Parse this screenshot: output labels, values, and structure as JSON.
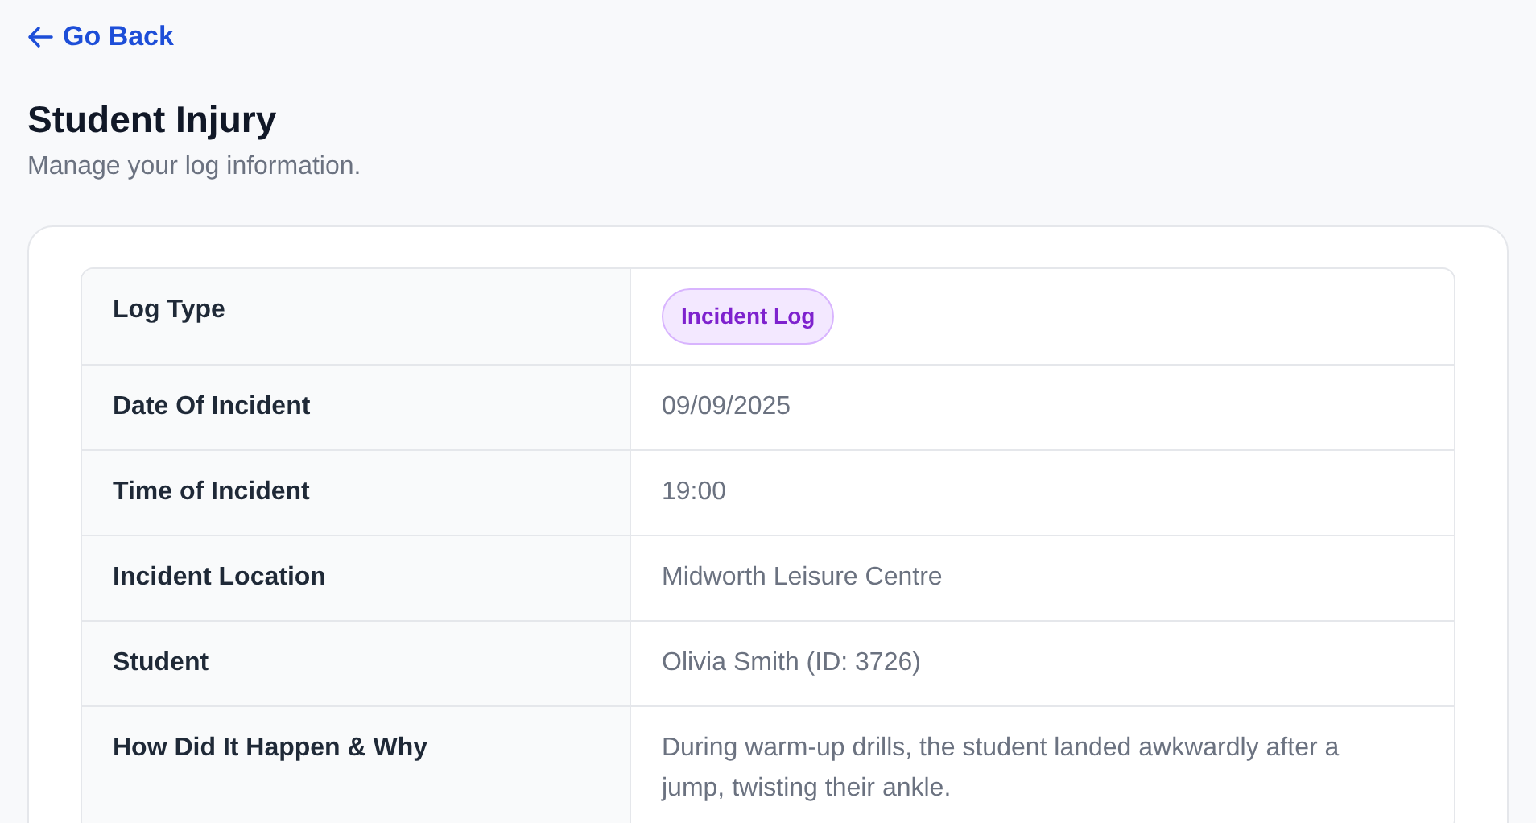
{
  "back_link": {
    "label": "Go Back"
  },
  "header": {
    "title": "Student Injury",
    "subtitle": "Manage your log information."
  },
  "details": [
    {
      "label": "Log Type",
      "kind": "badge",
      "value": "Incident Log"
    },
    {
      "label": "Date Of Incident",
      "kind": "text",
      "value": "09/09/2025"
    },
    {
      "label": "Time of Incident",
      "kind": "text",
      "value": "19:00"
    },
    {
      "label": "Incident Location",
      "kind": "text",
      "value": "Midworth Leisure Centre"
    },
    {
      "label": "Student",
      "kind": "text",
      "value": "Olivia Smith (ID: 3726)"
    },
    {
      "label": "How Did It Happen & Why",
      "kind": "text",
      "value": "During warm-up drills, the student landed awkwardly after a jump, twisting their ankle."
    }
  ]
}
